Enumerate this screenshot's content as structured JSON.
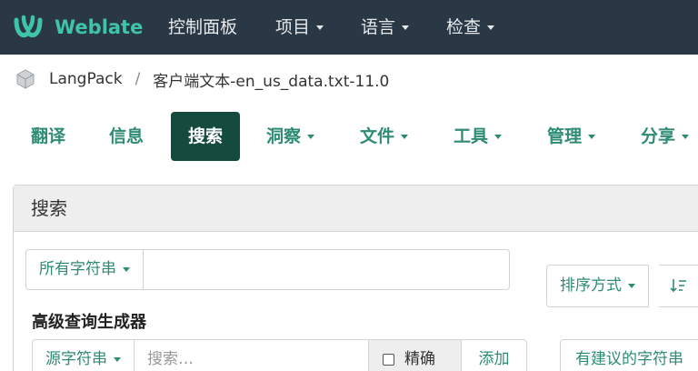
{
  "navbar": {
    "brand": "Weblate",
    "items": [
      {
        "label": "控制面板",
        "has_caret": false
      },
      {
        "label": "项目",
        "has_caret": true
      },
      {
        "label": "语言",
        "has_caret": true
      },
      {
        "label": "检查",
        "has_caret": true
      }
    ]
  },
  "breadcrumb": {
    "project": "LangPack",
    "separator": "/",
    "component": "客户端文本-en_us_data.txt-11.0"
  },
  "tabs": [
    {
      "label": "翻译",
      "active": false
    },
    {
      "label": "信息",
      "active": false
    },
    {
      "label": "搜索",
      "active": true
    },
    {
      "label": "洞察",
      "active": false
    },
    {
      "label": "文件",
      "active": false
    },
    {
      "label": "工具",
      "active": false
    },
    {
      "label": "管理",
      "active": false
    },
    {
      "label": "分享",
      "active": false
    }
  ],
  "search_panel": {
    "title": "搜索",
    "filter_dropdown": "所有字符串",
    "query_value": "",
    "sort_label": "排序方式",
    "sort_direction_icon": "sort-direction-icon",
    "advanced_builder_label": "高级查询生成器",
    "field_dropdown": "源字符串",
    "builder_placeholder": "搜索…",
    "exact_label": "精确",
    "add_label": "添加",
    "suggestion_dropdown": "有建议的字符串"
  },
  "colors": {
    "navbar_bg": "#2a3744",
    "brand": "#3ec5a7",
    "accent": "#2e8b74",
    "active_tab_bg": "#154a3f"
  }
}
